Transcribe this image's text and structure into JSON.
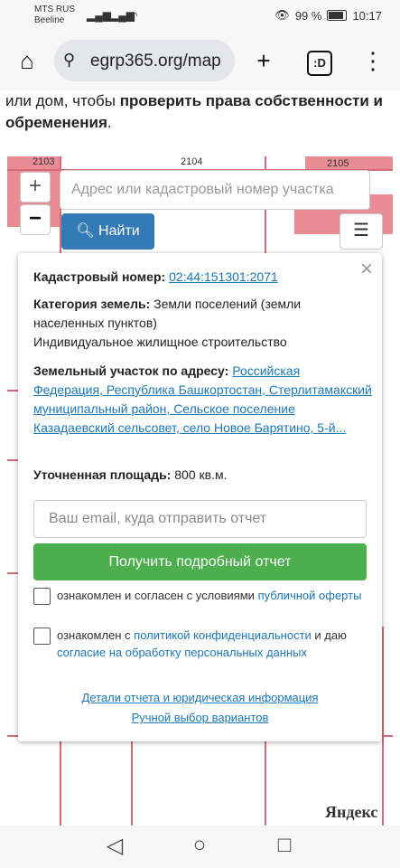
{
  "status": {
    "carrier1": "MTS RUS",
    "carrier2": "Beeline",
    "battery": "99 %",
    "time": "10:17"
  },
  "browser": {
    "url": "egrp365.org/map",
    "tabs_label": ":D"
  },
  "intro": {
    "before": "или дом, чтобы ",
    "bold": "проверить права собственности и обременения",
    "after": "."
  },
  "map": {
    "labels": [
      "2103",
      "2104",
      "2105"
    ],
    "zoom_in": "+",
    "zoom_out": "−",
    "search_placeholder": "Адрес или кадастровый номер участка",
    "find_label": "Найти",
    "menu_label": "☰",
    "attribution": "Яндекс",
    "colors": {
      "parcel": "#e88d96",
      "border": "#d26c79"
    }
  },
  "popup": {
    "close": "×",
    "cadastral_label": "Кадастровый номер:",
    "cadastral_number": "02:44:151301:2071",
    "category_label": "Категория земель:",
    "category_value": "Земли поселений (земли населенных пунктов)",
    "usage": "Индивидуальное жилищное строительство",
    "address_label": "Земельный участок по адресу:",
    "address_value": "Российская Федерация, Республика Башкортостан, Стерлитамакский муниципальный район, Сельское поселение Казадаевский сельсовет, село Новое Барятино, 5-й...",
    "area_label": "Уточненная площадь:",
    "area_value": "800 кв.м.",
    "email_placeholder": "Ваш email, куда отправить отчет",
    "report_button": "Получить подробный отчет",
    "consent1_text": "ознакомлен и согласен с условиями ",
    "consent1_link": "публичной оферты",
    "consent2_text1": "ознакомлен с ",
    "consent2_link1": "политикой конфиденциальности",
    "consent2_text2": " и даю ",
    "consent2_link2": "согласие на обработку персональных данных",
    "details_link": "Детали отчета и юридическая информация",
    "manual_link": "Ручной выбор вариантов"
  }
}
